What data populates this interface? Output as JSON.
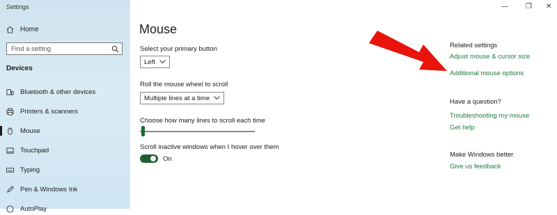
{
  "window": {
    "title": "Settings",
    "controls": {
      "minimize": "—",
      "maximize": "❐",
      "close": "✕"
    }
  },
  "sidebar": {
    "home_label": "Home",
    "search_placeholder": "Find a setting",
    "section_title": "Devices",
    "items": [
      {
        "label": "Bluetooth & other devices",
        "icon": "bluetooth-devices-icon"
      },
      {
        "label": "Printers & scanners",
        "icon": "printer-icon"
      },
      {
        "label": "Mouse",
        "icon": "mouse-icon",
        "active": true
      },
      {
        "label": "Touchpad",
        "icon": "touchpad-icon"
      },
      {
        "label": "Typing",
        "icon": "keyboard-icon"
      },
      {
        "label": "Pen & Windows Ink",
        "icon": "pen-icon"
      },
      {
        "label": "AutoPlay",
        "icon": "autoplay-icon"
      }
    ]
  },
  "main": {
    "title": "Mouse",
    "primary_button": {
      "label": "Select your primary button",
      "value": "Left"
    },
    "scroll_wheel": {
      "label": "Roll the mouse wheel to scroll",
      "value": "Multiple lines at a time"
    },
    "lines_slider": {
      "label": "Choose how many lines to scroll each time",
      "fraction": 0.03
    },
    "inactive_scroll": {
      "label": "Scroll inactive windows when I hover over them",
      "state_text": "On",
      "on": true
    }
  },
  "related": {
    "heading": "Related settings",
    "links": [
      "Adjust mouse & cursor size",
      "Additional mouse options"
    ]
  },
  "question": {
    "heading": "Have a question?",
    "links": [
      "Troubleshooting my mouse",
      "Get help"
    ]
  },
  "feedback": {
    "heading": "Make Windows better",
    "link": "Give us feedback"
  },
  "colors": {
    "accent_link": "#1e7b3c",
    "toggle_on": "#1e5e2f",
    "arrow": "#e8140c",
    "sidebar_bg": "#d3e7f2"
  }
}
